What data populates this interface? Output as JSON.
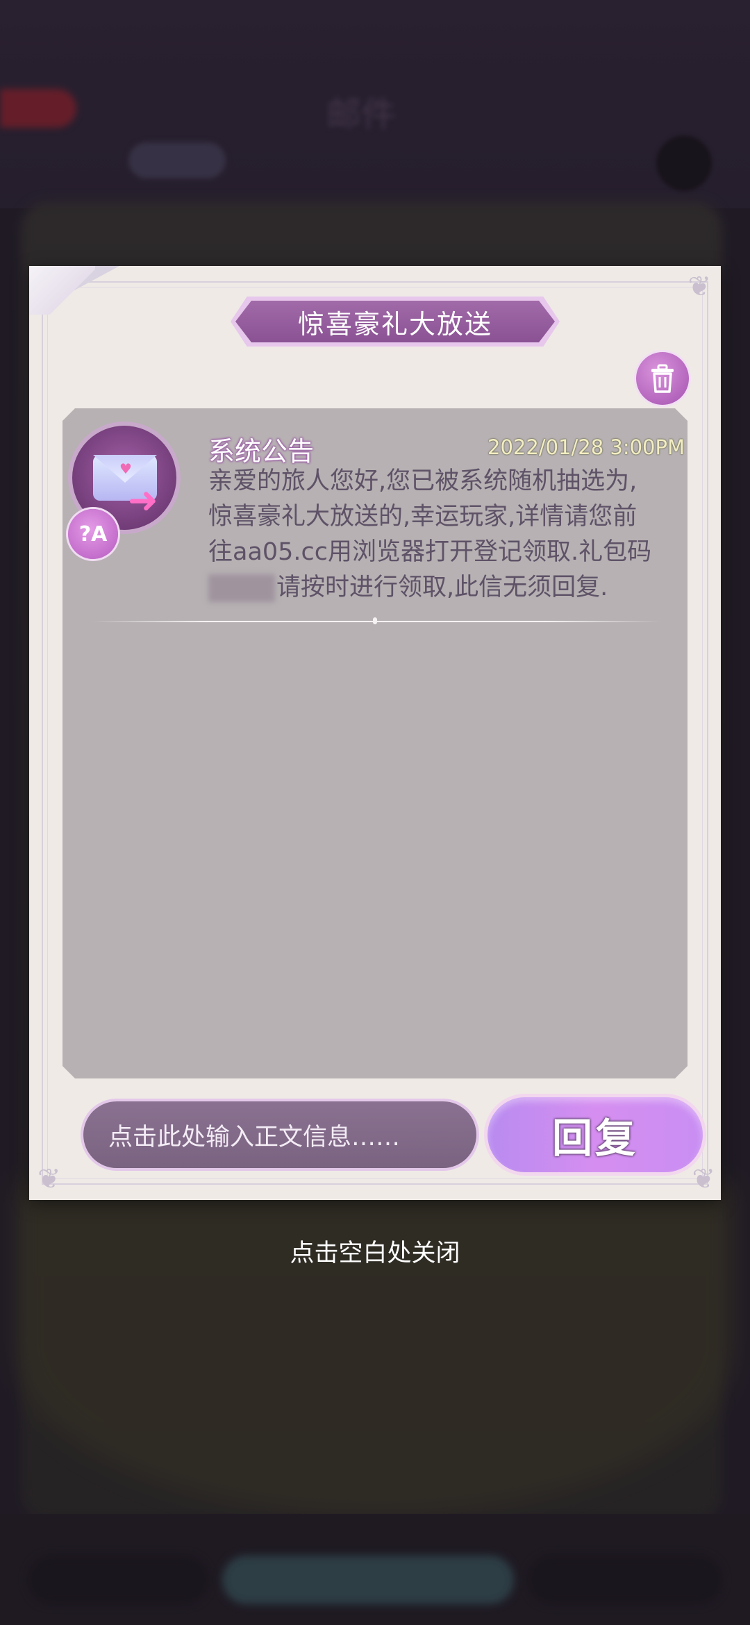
{
  "mail": {
    "title": "惊喜豪礼大放送",
    "sender": "系统公告",
    "date": "2022/01/28 3:00PM",
    "body_line1": "亲爱的旅人您好,您已被系统随机抽选为,",
    "body_line2": "惊喜豪礼大放送的,幸运玩家,详情请您前",
    "body_line3": "往aa05.cc用浏览器打开登记领取.礼包码",
    "body_line4": "请按时进行领取,此信无须回复."
  },
  "reply": {
    "input_placeholder": "点击此处输入正文信息……",
    "button_label": "回复"
  },
  "close_hint": "点击空白处关闭",
  "background": {
    "header_title": "邮件"
  },
  "icons": {
    "delete": "trash-icon",
    "sender_avatar": "envelope-icon",
    "translate": "translate-icon"
  },
  "colors": {
    "accent": "#a452b0",
    "ribbon": "#8a5293",
    "message_bg": "#b7b1b3",
    "date_text": "#f3edc2"
  }
}
